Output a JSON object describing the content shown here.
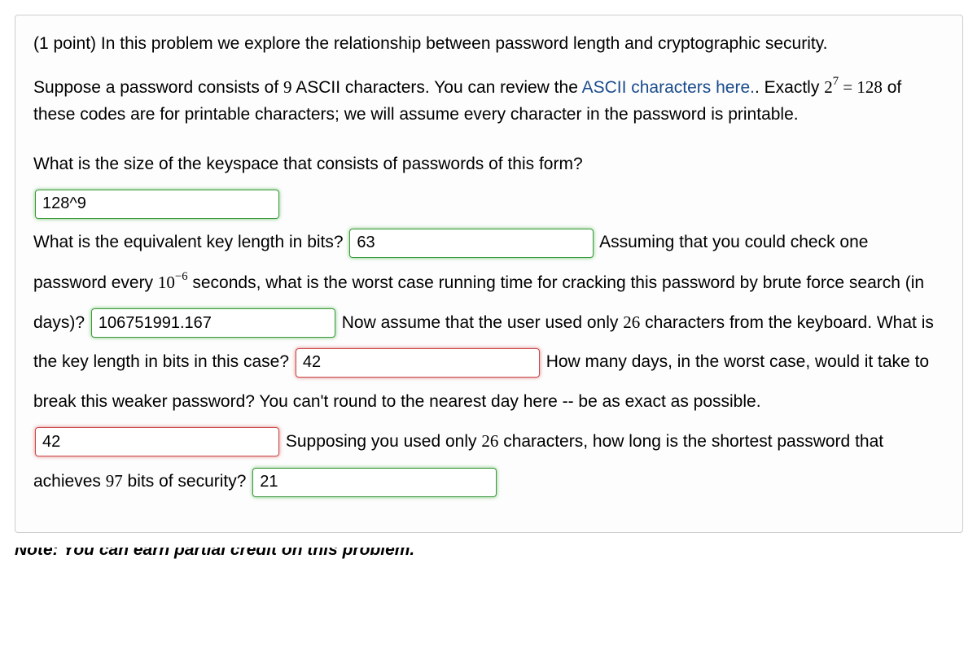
{
  "points": "(1 point)",
  "intro": "In this problem we explore the relationship between password length and cryptographic security.",
  "para2_a": "Suppose a password consists of ",
  "para2_nine": "9",
  "para2_b": " ASCII characters. You can review the ",
  "link_text": "ASCII characters here.",
  "para2_c": ". Exactly ",
  "math_2_7": "2",
  "math_2_7_exp": "7",
  "math_eq": " = ",
  "math_128": "128",
  "para2_d": " of these codes are for printable characters; we will assume every character in the password is printable.",
  "q1": "What is the size of the keyspace that consists of passwords of this form?",
  "a1": "128^9",
  "q2": "What is the equivalent key length in bits?",
  "a2": "63",
  "q3_a": "Assuming that you could check one password every ",
  "math_10": "10",
  "math_10_exp": "−6",
  "q3_b": " seconds, what is the worst case running time for cracking this password by brute force search (in days)?",
  "a3": "106751991.167",
  "q4_a": "Now assume that the user used only ",
  "num26": "26",
  "q4_b": " characters from the keyboard. What is the key length in bits in this case?",
  "a4": "42",
  "q5": "How many days, in the worst case, would it take to break this weaker password? You can't round to the nearest day here -- be as exact as possible.",
  "a5": "42",
  "q6_a": "Supposing you used only ",
  "q6_b": " characters, how long is the shortest password that achieves ",
  "num97": "97",
  "q6_c": " bits of security?",
  "a6": "21",
  "note_cut": "Note: You can earn partial credit on this problem."
}
